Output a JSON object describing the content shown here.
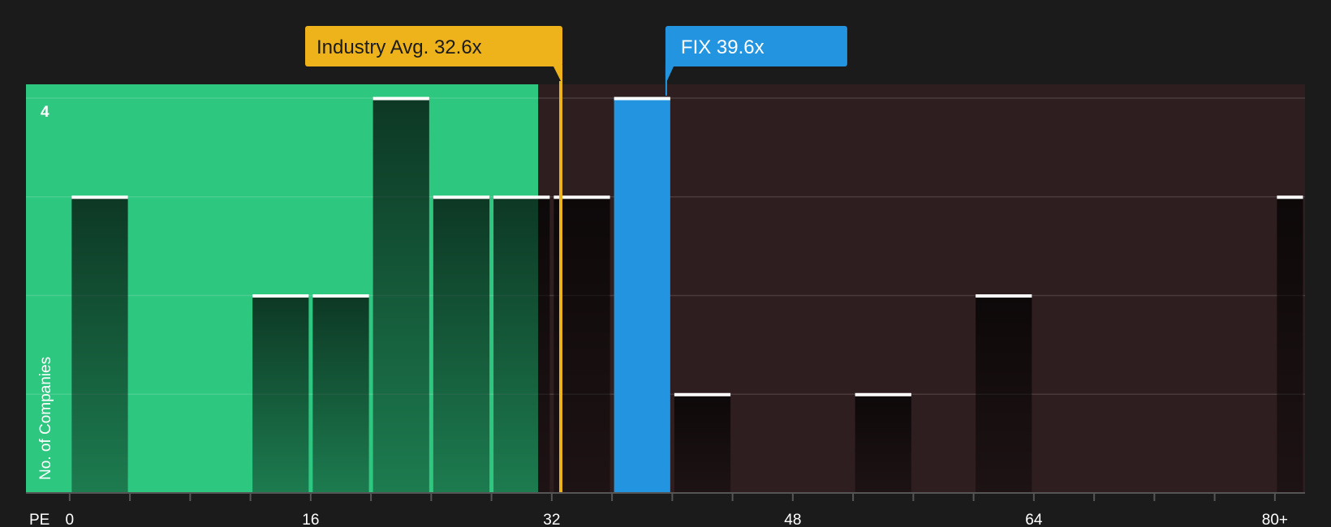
{
  "chart_data": {
    "type": "bar",
    "x_axis_label": "PE",
    "y_axis_label": "No. of Companies",
    "x_ticks": [
      "0",
      "16",
      "32",
      "48",
      "64",
      "80+"
    ],
    "x_tick_values": [
      0,
      16,
      32,
      48,
      64,
      80
    ],
    "x_range": [
      -2.9,
      82
    ],
    "y_tick_label": "4",
    "y_range": [
      0,
      4.14
    ],
    "bin_width": 4,
    "bins": [
      {
        "x_start": 0,
        "x_end": 4,
        "count": 3
      },
      {
        "x_start": 4,
        "x_end": 8,
        "count": 0
      },
      {
        "x_start": 8,
        "x_end": 12,
        "count": 0
      },
      {
        "x_start": 12,
        "x_end": 16,
        "count": 2
      },
      {
        "x_start": 16,
        "x_end": 20,
        "count": 2
      },
      {
        "x_start": 20,
        "x_end": 24,
        "count": 4
      },
      {
        "x_start": 24,
        "x_end": 28,
        "count": 3
      },
      {
        "x_start": 28,
        "x_end": 32,
        "count": 3
      },
      {
        "x_start": 32,
        "x_end": 36,
        "count": 3
      },
      {
        "x_start": 36,
        "x_end": 40,
        "count": 4,
        "highlight": true
      },
      {
        "x_start": 40,
        "x_end": 44,
        "count": 1
      },
      {
        "x_start": 44,
        "x_end": 48,
        "count": 0
      },
      {
        "x_start": 48,
        "x_end": 52,
        "count": 0
      },
      {
        "x_start": 52,
        "x_end": 56,
        "count": 1
      },
      {
        "x_start": 56,
        "x_end": 60,
        "count": 0
      },
      {
        "x_start": 60,
        "x_end": 64,
        "count": 2
      },
      {
        "x_start": 64,
        "x_end": 68,
        "count": 0
      },
      {
        "x_start": 68,
        "x_end": 72,
        "count": 0
      },
      {
        "x_start": 72,
        "x_end": 76,
        "count": 0
      },
      {
        "x_start": 76,
        "x_end": 80,
        "count": 0
      },
      {
        "x_start": 80,
        "x_end": 84,
        "count": 3
      }
    ],
    "industry_avg": {
      "label": "Industry Avg. 32.6x",
      "value": 32.6
    },
    "company": {
      "label": "FIX 39.6x",
      "value": 39.6
    },
    "shaded_regions": [
      {
        "from": -2.9,
        "to": 31.1,
        "meaning": "below average",
        "color": "#2ec780"
      },
      {
        "from": 31.1,
        "to": 82,
        "meaning": "above average",
        "color": "#2f1e20"
      }
    ],
    "colors": {
      "background": "#1b1b1b",
      "bar": "#1e1e1e",
      "bar_highlight": "#2394e0",
      "bar_cap": "#ffffff",
      "industry_avg": "#eeb31b",
      "company": "#2394e0",
      "grid": "#ffffff"
    },
    "grid": true
  }
}
